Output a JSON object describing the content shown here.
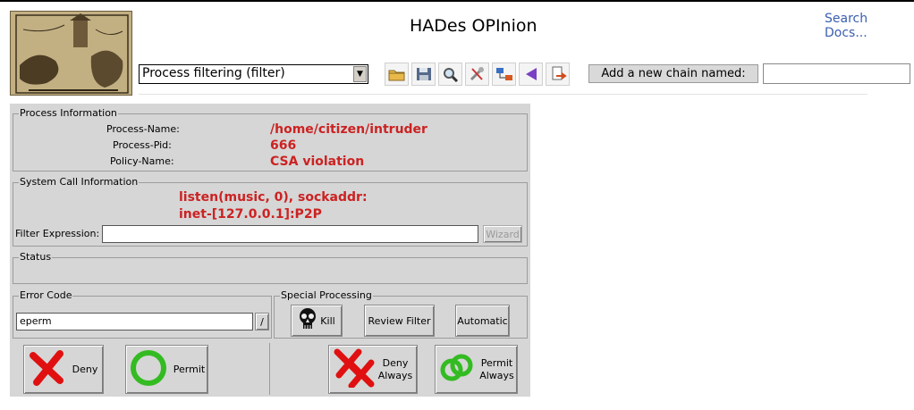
{
  "header": {
    "title": "HADes OPInion",
    "search_link": "Search Docs..."
  },
  "toolbar": {
    "chain_select": "Process filtering (filter)",
    "add_chain_label": "Add a new chain named:",
    "add_chain_value": "",
    "icons": [
      "open-folder-icon",
      "save-icon",
      "find-icon",
      "tools-icon",
      "network-icon",
      "back-arrow-icon",
      "import-icon"
    ]
  },
  "process": {
    "group_label": "Process Information",
    "name_label": "Process-Name:",
    "name_value": "/home/citizen/intruder",
    "pid_label": "Process-Pid:",
    "pid_value": "666",
    "policy_label": "Policy-Name:",
    "policy_value": "CSA violation"
  },
  "syscall": {
    "group_label": "System Call Information",
    "line1": "listen(music, 0), sockaddr:",
    "line2": "inet-[127.0.0.1]:P2P",
    "filter_label": "Filter Expression:",
    "filter_value": "",
    "wizard_label": "Wizard"
  },
  "status": {
    "group_label": "Status",
    "text": ""
  },
  "error_code": {
    "group_label": "Error Code",
    "value": "eperm",
    "button_label": "/"
  },
  "special": {
    "group_label": "Special Processing",
    "kill_label": "Kill",
    "review_label": "Review Filter",
    "automatic_label": "Automatic"
  },
  "actions": {
    "deny": "Deny",
    "permit": "Permit",
    "deny_always_1": "Deny",
    "deny_always_2": "Always",
    "permit_always_1": "Permit",
    "permit_always_2": "Always"
  },
  "colors": {
    "highlight_text": "#cc2222",
    "panel_bg": "#d6d6d6",
    "link": "#3a5eb0",
    "deny_red": "#e01010",
    "permit_green": "#33bb22"
  }
}
